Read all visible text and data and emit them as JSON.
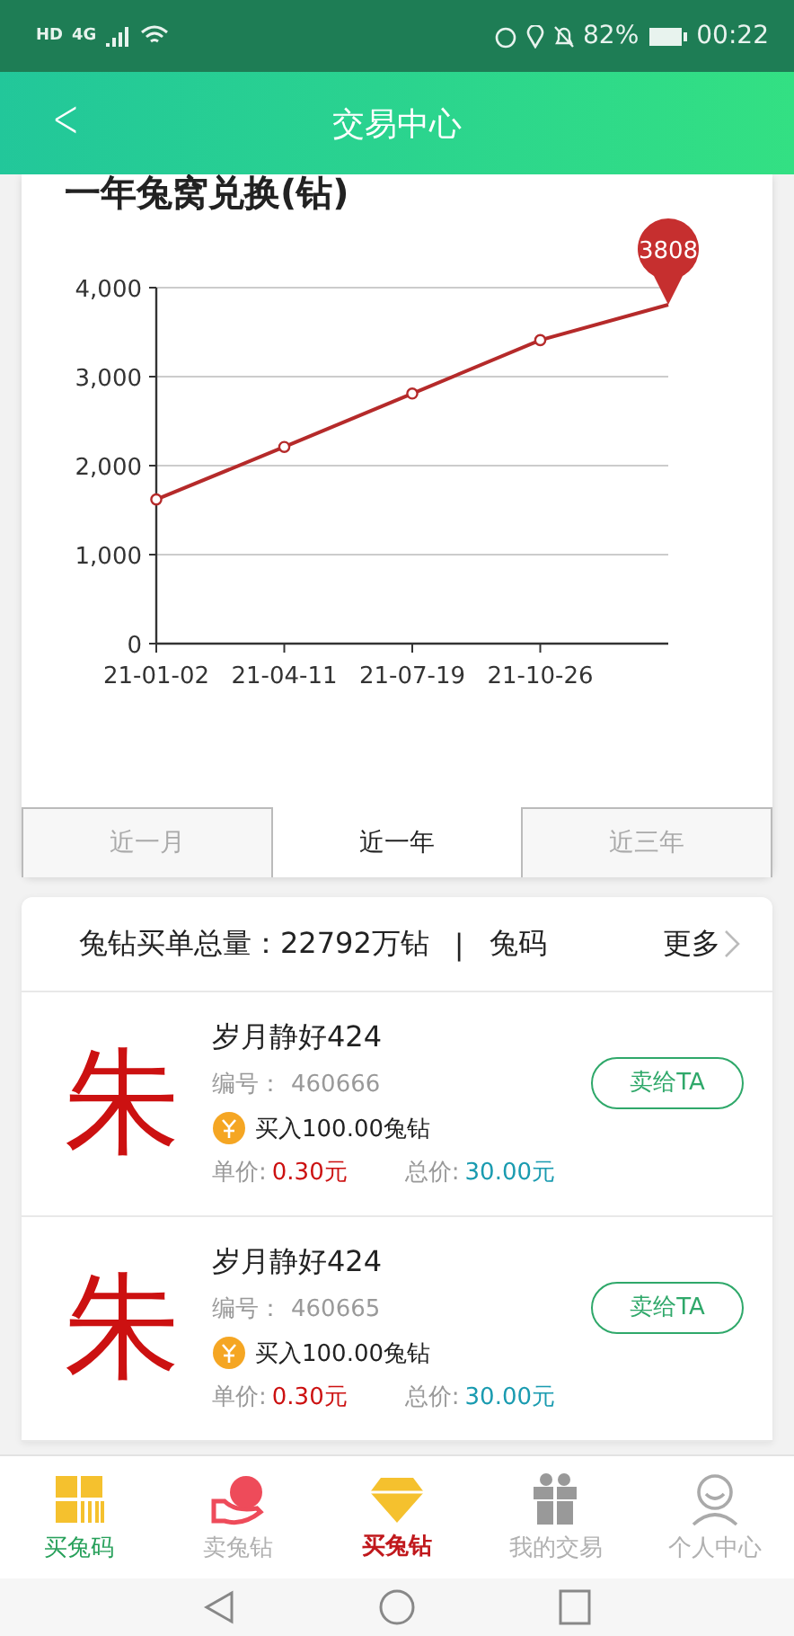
{
  "status_bar": {
    "left": "HD",
    "network": "4G",
    "battery": "82%",
    "time": "00:22"
  },
  "header": {
    "back": "<",
    "title": "交易中心"
  },
  "chart_card": {
    "title": "一年兔窝兑换(钻)",
    "chart_data": {
      "type": "line",
      "categories": [
        "21-01-02",
        "21-04-11",
        "21-07-19",
        "21-10-26",
        null
      ],
      "grid": true,
      "series": [
        {
          "color": "#b52a2a",
          "marker": true,
          "values": [
            1620,
            2210,
            2810,
            3410,
            3808
          ]
        }
      ],
      "ylim": [
        0,
        4000
      ],
      "yticks": [
        {
          "value": 0,
          "label": "0"
        },
        {
          "value": 1000,
          "label": "1,000"
        },
        {
          "value": 2000,
          "label": "2,000"
        },
        {
          "value": 3000,
          "label": "3,000"
        },
        {
          "value": 4000,
          "label": "4,000"
        }
      ],
      "annotations": [
        {
          "y": 3808,
          "text": "3808"
        }
      ]
    },
    "tabs": [
      {
        "label": "近一月",
        "selected": false
      },
      {
        "label": "近一年",
        "selected": true
      },
      {
        "label": "近三年",
        "selected": false
      }
    ]
  },
  "orders": {
    "summary": "兔钻买单总量：22792万钻",
    "separator": "|",
    "code_label": "兔码",
    "more": "更多",
    "rows": [
      {
        "avatar": "朱",
        "name": "岁月静好424",
        "number_label": "编号：",
        "number": "460666",
        "buy": "买入100.00兔钻",
        "unit_label": "单价:",
        "unit_price": "0.30元",
        "total_label": "总价:",
        "total_price": "30.00元",
        "action": "卖给TA"
      },
      {
        "avatar": "朱",
        "name": "岁月静好424",
        "number_label": "编号：",
        "number": "460665",
        "buy": "买入100.00兔钻",
        "unit_label": "单价:",
        "unit_price": "0.30元",
        "total_label": "总价:",
        "total_price": "30.00元",
        "action": "卖给TA"
      }
    ]
  },
  "bottom_nav": [
    {
      "kind": "grid",
      "label": "买兔码",
      "color": "#27a05a",
      "selected": false
    },
    {
      "kind": "hand",
      "label": "卖兔钻",
      "color": "#b0b0b0",
      "selected": false
    },
    {
      "kind": "diamond",
      "label": "买兔钻",
      "color": "#c0181c",
      "selected": true
    },
    {
      "kind": "gift",
      "label": "我的交易",
      "color": "#b0b0b0",
      "selected": false
    },
    {
      "kind": "person",
      "label": "个人中心",
      "color": "#b0b0b0",
      "selected": false
    }
  ]
}
